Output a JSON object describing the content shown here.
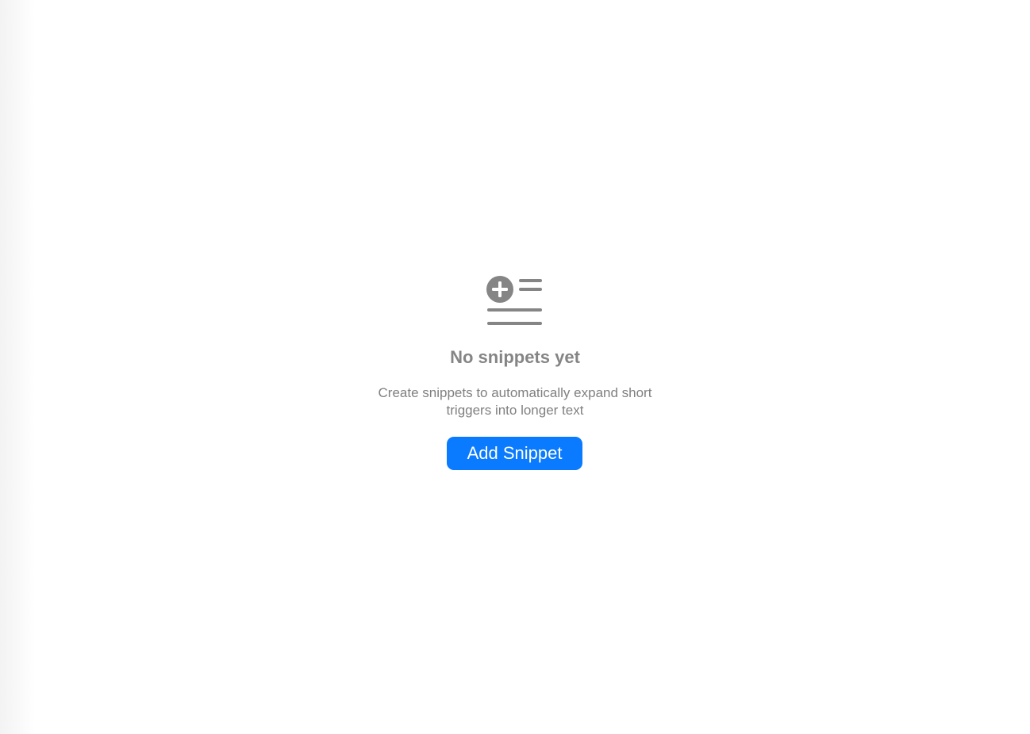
{
  "empty_state": {
    "icon": "list-add-icon",
    "title": "No snippets yet",
    "description": "Create snippets to automatically expand short triggers into longer text",
    "add_button_label": "Add Snippet"
  },
  "colors": {
    "accent": "#0a7aff",
    "icon": "#858585",
    "title": "#858585",
    "description": "#808080",
    "background": "#ffffff"
  }
}
